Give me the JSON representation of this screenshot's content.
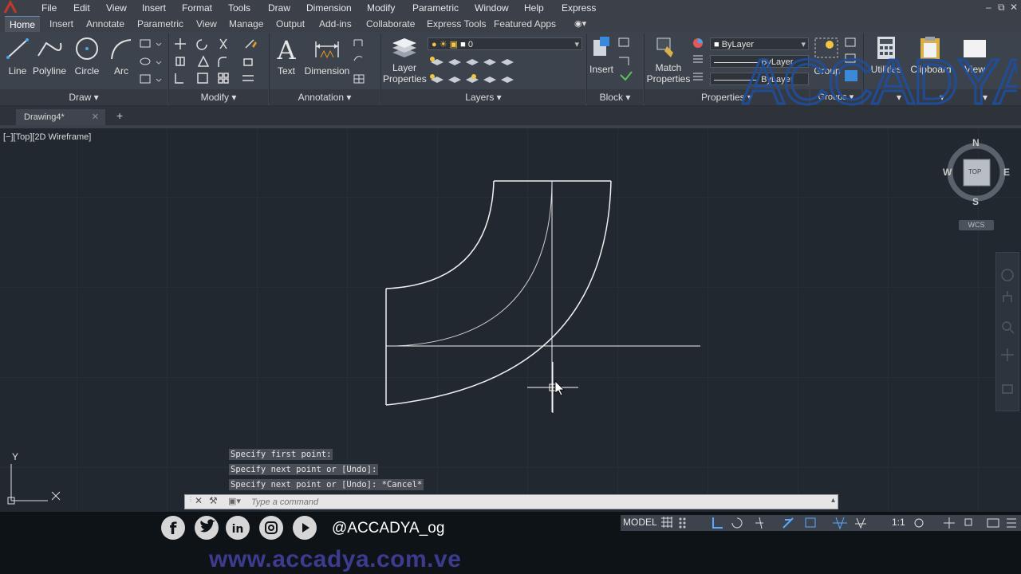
{
  "menu": [
    "File",
    "Edit",
    "View",
    "Insert",
    "Format",
    "Tools",
    "Draw",
    "Dimension",
    "Modify",
    "Parametric",
    "Window",
    "Help",
    "Express"
  ],
  "ribbon_tabs": [
    "Home",
    "Insert",
    "Annotate",
    "Parametric",
    "View",
    "Manage",
    "Output",
    "Add-ins",
    "Collaborate",
    "Express Tools",
    "Featured Apps"
  ],
  "active_tab": "Home",
  "draw_panel": {
    "title": "Draw",
    "tools": [
      "Line",
      "Polyline",
      "Circle",
      "Arc"
    ]
  },
  "modify_panel": {
    "title": "Modify"
  },
  "annotation_panel": {
    "title": "Annotation",
    "tools": [
      "Text",
      "Dimension"
    ]
  },
  "layers_panel": {
    "title": "Layers",
    "layer_properties": "Layer\nProperties",
    "current_layer": "0"
  },
  "block_panel": {
    "title": "Block",
    "insert": "Insert"
  },
  "properties_panel": {
    "title": "Properties",
    "match_properties": "Match\nProperties",
    "color": "ByLayer",
    "linetype": "ByLayer",
    "lineweight": "ByLayer"
  },
  "groups_panel": {
    "title": "Groups",
    "group": "Group"
  },
  "utilities": "Utilities",
  "clipboard": "Clipboard",
  "view_label": "View",
  "watermark": "ACCADYA",
  "file_tab": "Drawing4*",
  "viewport_label": "[−][Top][2D Wireframe]",
  "viewcube": {
    "n": "N",
    "s": "S",
    "e": "E",
    "w": "W",
    "top": "TOP",
    "wcs": "WCS"
  },
  "ucs": {
    "x": "X",
    "y": "Y"
  },
  "command_history": [
    "Specify first point:",
    "Specify next point or [Undo]:",
    "Specify next point or [Undo]: *Cancel*"
  ],
  "command_placeholder": "Type a command",
  "status": {
    "model": "MODEL",
    "scale": "1:1"
  },
  "social_handle": "@ACCADYA_og",
  "website": "www.accadya.com.ve",
  "colors": {
    "canvas": "#212830",
    "ribbon": "#3d434c",
    "watermark": "#1e4fa0",
    "website": "#3d3b8e"
  }
}
